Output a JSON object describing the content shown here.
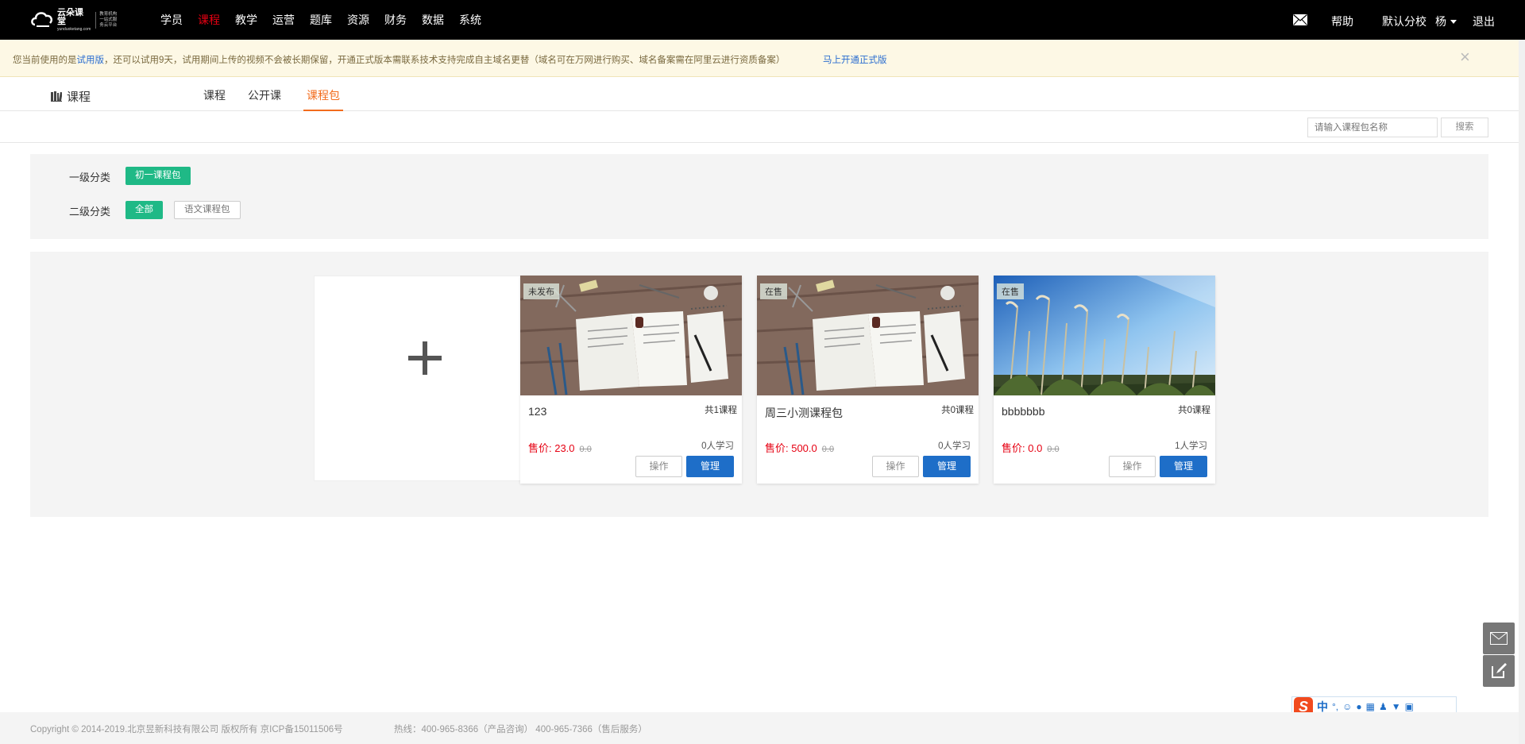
{
  "topbar": {
    "logo_name": "云朵课堂",
    "logo_domain": "yunduoketang.com",
    "logo_slogan": "教育机构一站式服务云平台",
    "nav": [
      "学员",
      "课程",
      "教学",
      "运营",
      "题库",
      "资源",
      "财务",
      "数据",
      "系统"
    ],
    "active_nav": "课程",
    "help": "帮助",
    "school": "默认分校",
    "user": "杨",
    "logout": "退出"
  },
  "notice": {
    "text_prefix": "您当前使用的是",
    "trial_link": "试用版",
    "text_body": "，还可以试用9天，试用期间上传的视频不会被长期保留，开通正式版本需联系技术支持完成自主域名更替（域名可在万网进行购买、域名备案需在阿里云进行资质备案）",
    "upgrade_link": "马上开通正式版",
    "close": "×"
  },
  "subheader": {
    "title": "课程",
    "tabs": [
      "课程",
      "公开课",
      "课程包"
    ],
    "active_tab": "课程包"
  },
  "search": {
    "placeholder": "请输入课程包名称",
    "button": "搜索"
  },
  "filters": {
    "level1_label": "一级分类",
    "level1_options": [
      "初一课程包"
    ],
    "level2_label": "二级分类",
    "level2_options": [
      "全部",
      "语文课程包"
    ]
  },
  "cards": [
    {
      "status": "未发布",
      "name": "123",
      "count": "共1课程",
      "price": "售价: 23.0",
      "old_price": "0.0",
      "learners": "0人学习",
      "op": "操作",
      "manage": "管理",
      "image": "desk-books"
    },
    {
      "status": "在售",
      "name": "周三小测课程包",
      "count": "共0课程",
      "price": "售价: 500.0",
      "old_price": "0.0",
      "learners": "0人学习",
      "op": "操作",
      "manage": "管理",
      "image": "desk-books"
    },
    {
      "status": "在售",
      "name": "bbbbbbb",
      "count": "共0课程",
      "price": "售价: 0.0",
      "old_price": "0.0",
      "learners": "1人学习",
      "op": "操作",
      "manage": "管理",
      "image": "grass-sky"
    }
  ],
  "ime": {
    "zh": "中",
    "symbols": "°,"
  },
  "footer": {
    "copyright": "Copyright © 2014-2019.北京昱新科技有限公司 版权所有 京ICP备15011506号",
    "hotline": "热线：400-965-8366（产品咨询） 400-965-7366（售后服务）"
  },
  "colors": {
    "accent_orange": "#f26c1d",
    "active_nav_red": "#e60012",
    "chip_green": "#1fb986",
    "manage_blue": "#1e6ec8"
  }
}
